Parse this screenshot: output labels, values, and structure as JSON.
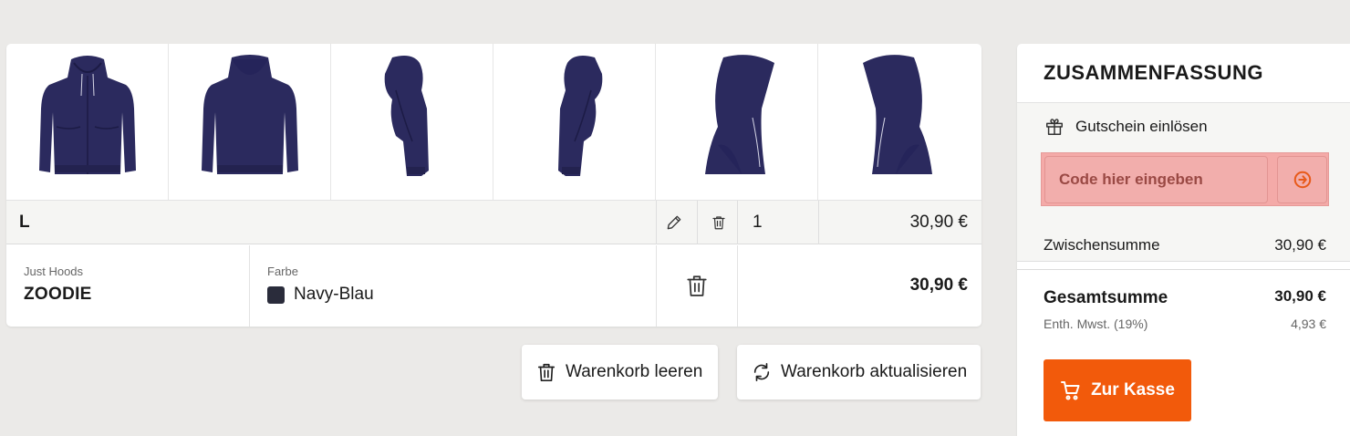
{
  "cart": {
    "product_views": [
      {
        "name": "front"
      },
      {
        "name": "back"
      },
      {
        "name": "left"
      },
      {
        "name": "right"
      },
      {
        "name": "hood-left"
      },
      {
        "name": "hood-right"
      }
    ],
    "product_color_hex": "#2b2a5e",
    "size_row": {
      "size": "L",
      "quantity": "1",
      "price": "30,90 €"
    },
    "product": {
      "brand": "Just Hoods",
      "name": "ZOODIE",
      "color_label": "Farbe",
      "color_value": "Navy-Blau",
      "total": "30,90 €"
    },
    "actions": {
      "clear_label": "Warenkorb leeren",
      "update_label": "Warenkorb aktualisieren"
    }
  },
  "summary": {
    "title": "ZUSAMMENFASSUNG",
    "coupon_label": "Gutschein einlösen",
    "coupon_placeholder": "Code hier eingeben",
    "subtotal_label": "Zwischensumme",
    "subtotal_value": "30,90 €",
    "total_label": "Gesamtsumme",
    "total_value": "30,90 €",
    "vat_label": "Enth. Mwst. (19%)",
    "vat_value": "4,93 €",
    "checkout_label": "Zur Kasse",
    "accent_color": "#f25a0b"
  }
}
